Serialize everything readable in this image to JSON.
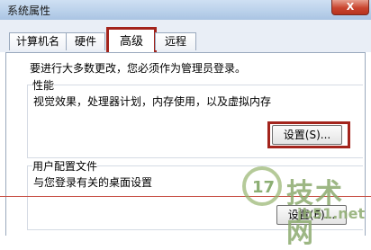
{
  "window": {
    "title": "系统属性",
    "close_glyph": "X"
  },
  "tabs": [
    {
      "label": "计算机名",
      "active": false
    },
    {
      "label": "硬件",
      "active": false
    },
    {
      "label": "高级",
      "active": true
    },
    {
      "label": "远程",
      "active": false
    }
  ],
  "admin_note": "要进行大多数更改，您必须作为管理员登录。",
  "performance": {
    "title": "性能",
    "description": "视觉效果，处理器计划，内存使用，以及虚拟内存",
    "button_label": "设置(S)..."
  },
  "user_profiles": {
    "title": "用户配置文件",
    "description": "与您登录有关的桌面设置",
    "button_label": "设置(E)..."
  },
  "watermark": {
    "logo_text": "17",
    "brand": "技术网",
    "url": "jb51.net"
  },
  "colors": {
    "highlight": "#a3241c",
    "close_button": "#c9452f",
    "titlebar": "#b9d0ea",
    "watermark": "#8caa6e"
  }
}
